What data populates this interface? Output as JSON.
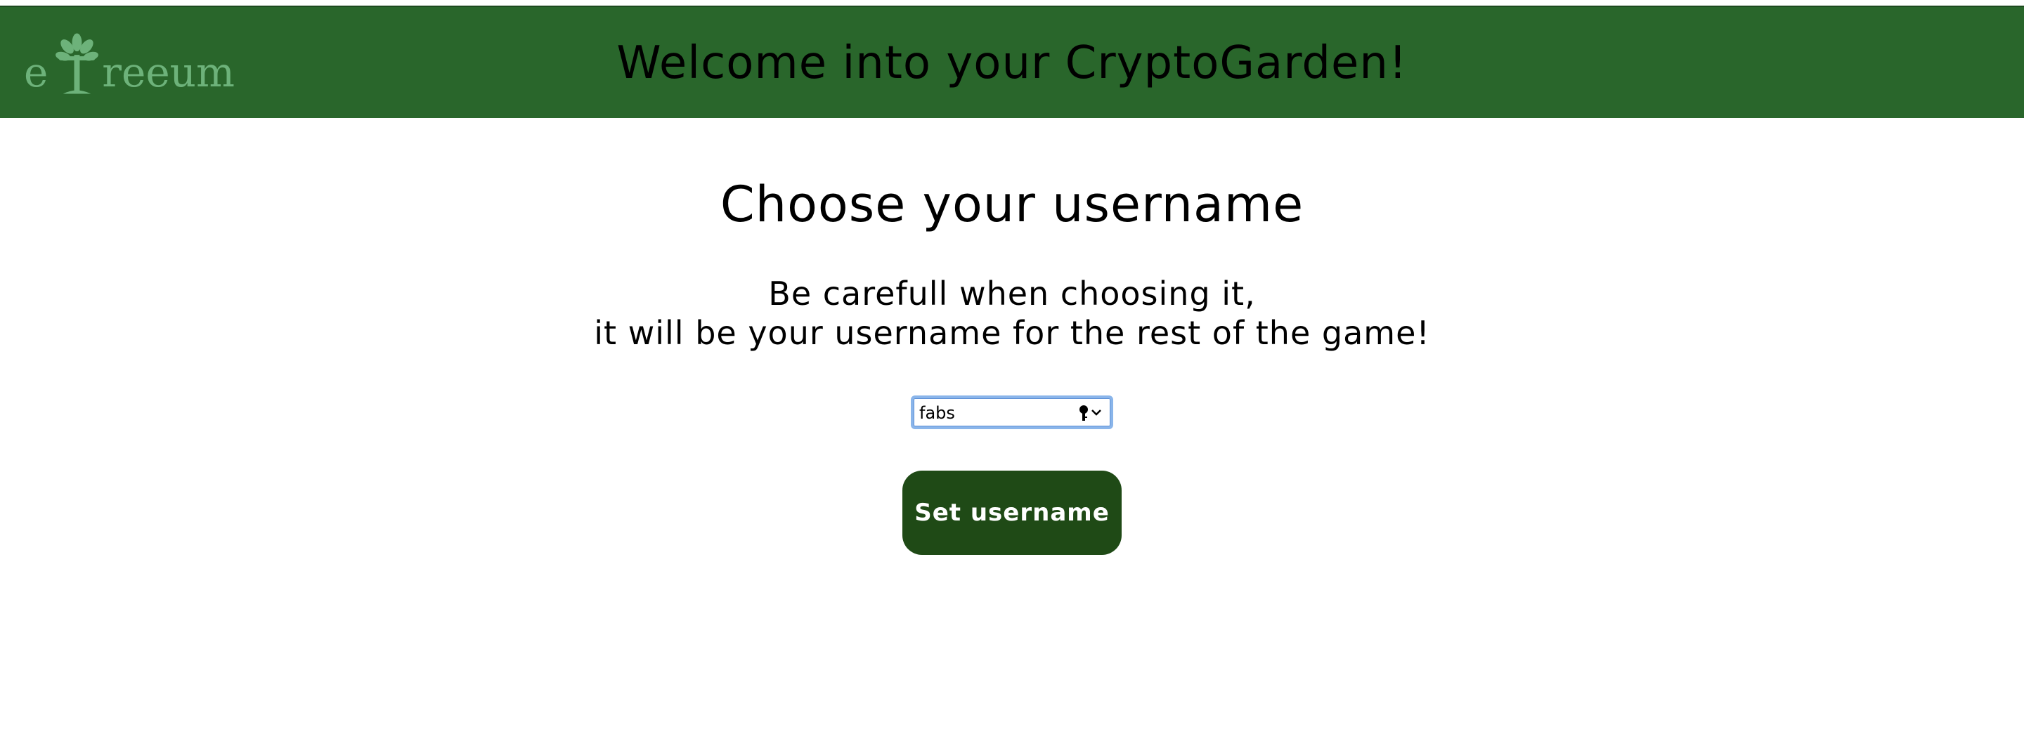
{
  "header": {
    "title": "Welcome into your CryptoGarden!",
    "logo_text_prefix": "e",
    "logo_text_suffix": "reeum",
    "background_color": "#29662b",
    "logo_color": "#6db27a"
  },
  "main": {
    "heading": "Choose your username",
    "subtext_line1": "Be carefull when choosing it,",
    "subtext_line2": "it will be your username for the rest of the game!",
    "username_input": {
      "value": "fabs",
      "placeholder": ""
    },
    "key_icon": "key-icon",
    "chevron_icon": "chevron-down-icon",
    "submit_button": {
      "label": "Set username",
      "color": "#1f4a16"
    }
  }
}
